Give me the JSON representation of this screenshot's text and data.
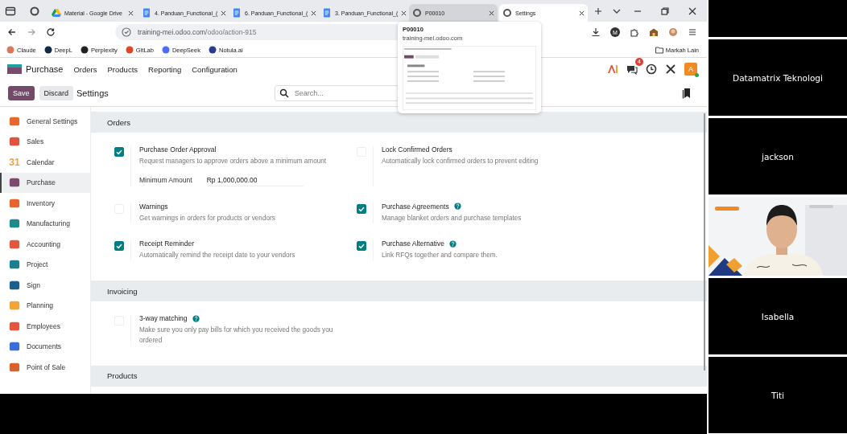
{
  "browser": {
    "tabs": [
      {
        "title": "Material - Google Drive",
        "kind": "drive",
        "selected": false,
        "hovered": false
      },
      {
        "title": "4. Panduan_Functional_(",
        "kind": "doc",
        "selected": false,
        "hovered": false
      },
      {
        "title": "6. Panduan_Functional_(",
        "kind": "doc",
        "selected": false,
        "hovered": false
      },
      {
        "title": "3. Panduan_Functional_(",
        "kind": "doc",
        "selected": false,
        "hovered": false
      },
      {
        "title": "P00010",
        "kind": "web",
        "selected": false,
        "hovered": true
      },
      {
        "title": "Settings",
        "kind": "web",
        "selected": true,
        "hovered": false
      }
    ],
    "address_host": "training-mei.odoo.com",
    "address_path": "/odoo/action-915",
    "profile_initial": "M",
    "bookmarks": [
      {
        "label": "Claude",
        "color": "#d97757"
      },
      {
        "label": "DeepL",
        "color": "#0f2b46"
      },
      {
        "label": "Perplexity",
        "color": "#222222"
      },
      {
        "label": "GitLab",
        "color": "#e24329"
      },
      {
        "label": "DeepSeek",
        "color": "#4d6bfe"
      },
      {
        "label": "Notula.ai",
        "color": "#2a3b8f"
      }
    ],
    "other_bookmarks": "Markah Lain"
  },
  "tab_preview": {
    "title": "P00010",
    "url": "training-mei.odoo.com"
  },
  "app": {
    "name": "Purchase",
    "menu": [
      "Orders",
      "Products",
      "Reporting",
      "Configuration"
    ],
    "message_count": "4",
    "user_initial": "A"
  },
  "control": {
    "save": "Save",
    "discard": "Discard",
    "title": "Settings",
    "search_placeholder": "Search..."
  },
  "sidebar": [
    {
      "label": "General Settings",
      "color": "#e8672b",
      "selected": false
    },
    {
      "label": "Sales",
      "color": "#e0533f",
      "selected": false
    },
    {
      "label": "Calendar",
      "color": "#f0a04b",
      "icon_text": "31",
      "selected": false
    },
    {
      "label": "Purchase",
      "color": "#7c4a6c",
      "selected": true
    },
    {
      "label": "Inventory",
      "color": "#e8642f",
      "selected": false
    },
    {
      "label": "Manufacturing",
      "color": "#1f8a8a",
      "selected": false
    },
    {
      "label": "Accounting",
      "color": "#e2583e",
      "selected": false
    },
    {
      "label": "Project",
      "color": "#1a7f8e",
      "selected": false
    },
    {
      "label": "Sign",
      "color": "#1c5f8a",
      "selected": false
    },
    {
      "label": "Planning",
      "color": "#f0a43a",
      "selected": false
    },
    {
      "label": "Employees",
      "color": "#e2583e",
      "selected": false
    },
    {
      "label": "Documents",
      "color": "#3b6fd8",
      "selected": false
    },
    {
      "label": "Point of Sale",
      "color": "#d9622b",
      "selected": false
    }
  ],
  "sections": [
    {
      "title": "Orders",
      "settings": [
        {
          "title": "Purchase Order Approval",
          "description": "Request managers to approve orders above a minimum amount",
          "checked": true,
          "field": {
            "label": "Minimum Amount",
            "value": "Rp 1,000,000.00"
          }
        },
        {
          "title": "Lock Confirmed Orders",
          "description": "Automatically lock confirmed orders to prevent editing",
          "checked": false
        },
        {
          "title": "Warnings",
          "description": "Get warnings in orders for products or vendors",
          "checked": false
        },
        {
          "title": "Purchase Agreements",
          "description": "Manage blanket orders and purchase templates",
          "checked": true,
          "help": true
        },
        {
          "title": "Receipt Reminder",
          "description": "Automatically remind the receipt date to your vendors",
          "checked": true
        },
        {
          "title": "Purchase Alternative",
          "description": "Link RFQs together and compare them.",
          "checked": true,
          "help": true
        }
      ]
    },
    {
      "title": "Invoicing",
      "settings": [
        {
          "title": "3-way matching",
          "description": "Make sure you only pay bills for which you received the goods you ordered",
          "checked": false,
          "help": true
        }
      ]
    },
    {
      "title": "Products"
    }
  ],
  "participants": [
    {
      "kind": "blank"
    },
    {
      "kind": "name",
      "name": "Datamatrix Teknologi"
    },
    {
      "kind": "name",
      "name": "jackson"
    },
    {
      "kind": "picture"
    },
    {
      "kind": "name",
      "name": "Isabella"
    },
    {
      "kind": "name",
      "name": "Titi"
    }
  ]
}
